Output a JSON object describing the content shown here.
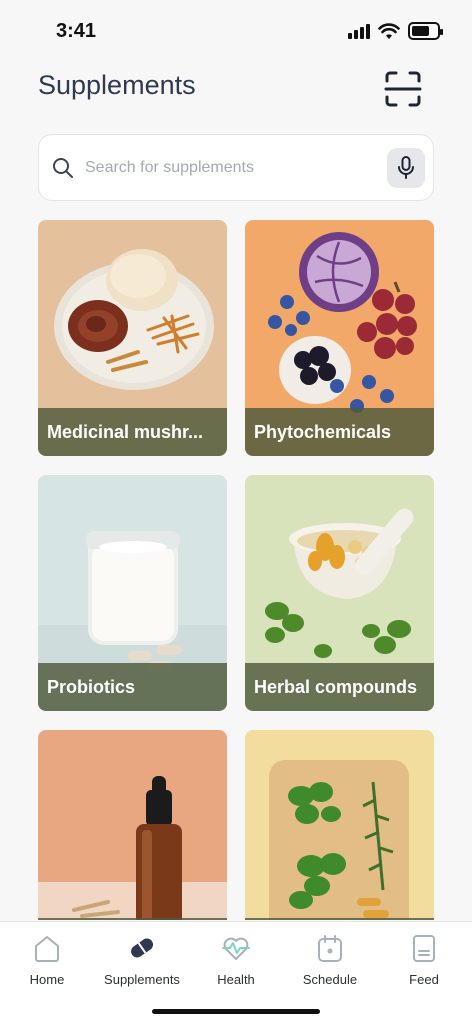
{
  "status_bar": {
    "time": "3:41"
  },
  "header": {
    "title": "Supplements"
  },
  "search": {
    "placeholder": "Search for supplements"
  },
  "categories": [
    {
      "label": "Medicinal mushr..."
    },
    {
      "label": "Phytochemicals"
    },
    {
      "label": "Probiotics"
    },
    {
      "label": "Herbal compounds"
    },
    {
      "label": ""
    },
    {
      "label": ""
    }
  ],
  "bottom_nav": {
    "items": [
      {
        "label": "Home",
        "icon": "home-icon"
      },
      {
        "label": "Supplements",
        "icon": "pill-icon",
        "active": true
      },
      {
        "label": "Health",
        "icon": "heartbeat-icon"
      },
      {
        "label": "Schedule",
        "icon": "calendar-icon"
      },
      {
        "label": "Feed",
        "icon": "feed-icon"
      }
    ]
  },
  "colors": {
    "title": "#2e3a52",
    "label_bar": "#4e5a3a",
    "active_nav": "#2e3a52",
    "inactive_nav": "#a7b0bd"
  }
}
